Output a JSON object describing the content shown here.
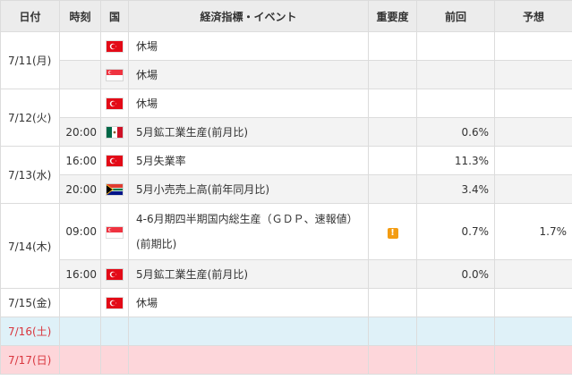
{
  "headers": {
    "date": "日付",
    "time": "時刻",
    "country": "国",
    "event": "経済指標・イベント",
    "importance": "重要度",
    "previous": "前回",
    "forecast": "予想"
  },
  "rows": {
    "r1": {
      "date": "7/11(月)",
      "time": "",
      "flag": "turkey-flag-icon",
      "event": "休場",
      "previous": "",
      "forecast": ""
    },
    "r2": {
      "time": "",
      "flag": "singapore-flag-icon",
      "event": "休場",
      "previous": "",
      "forecast": ""
    },
    "r3": {
      "date": "7/12(火)",
      "time": "",
      "flag": "turkey-flag-icon",
      "event": "休場",
      "previous": "",
      "forecast": ""
    },
    "r4": {
      "time": "20:00",
      "flag": "mexico-flag-icon",
      "event": "5月鉱工業生産(前月比)",
      "previous": "0.6%",
      "forecast": ""
    },
    "r5": {
      "date": "7/13(水)",
      "time": "16:00",
      "flag": "turkey-flag-icon",
      "event": "5月失業率",
      "previous": "11.3%",
      "forecast": ""
    },
    "r6": {
      "time": "20:00",
      "flag": "south-africa-flag-icon",
      "event": "5月小売売上高(前年同月比)",
      "previous": "3.4%",
      "forecast": ""
    },
    "r7": {
      "date": "7/14(木)",
      "time": "09:00",
      "flag": "singapore-flag-icon",
      "event": "4-6月期四半期国内総生産（ＧＤＰ、速報値）(前期比)",
      "importance": "!",
      "previous": "0.7%",
      "forecast": "1.7%"
    },
    "r8": {
      "time": "16:00",
      "flag": "turkey-flag-icon",
      "event": "5月鉱工業生産(前月比)",
      "previous": "0.0%",
      "forecast": ""
    },
    "r9": {
      "date": "7/15(金)",
      "time": "",
      "flag": "turkey-flag-icon",
      "event": "休場",
      "previous": "",
      "forecast": ""
    },
    "r10": {
      "date": "7/16(土)"
    },
    "r11": {
      "date": "7/17(日)"
    }
  },
  "colors": {
    "header_bg": "#ececec",
    "alt_row_bg": "#f3f3f3",
    "saturday_bg": "#dff1f8",
    "sunday_bg": "#fdd6da",
    "weekend_text": "#d9363e",
    "importance_badge": "#f39c12"
  }
}
